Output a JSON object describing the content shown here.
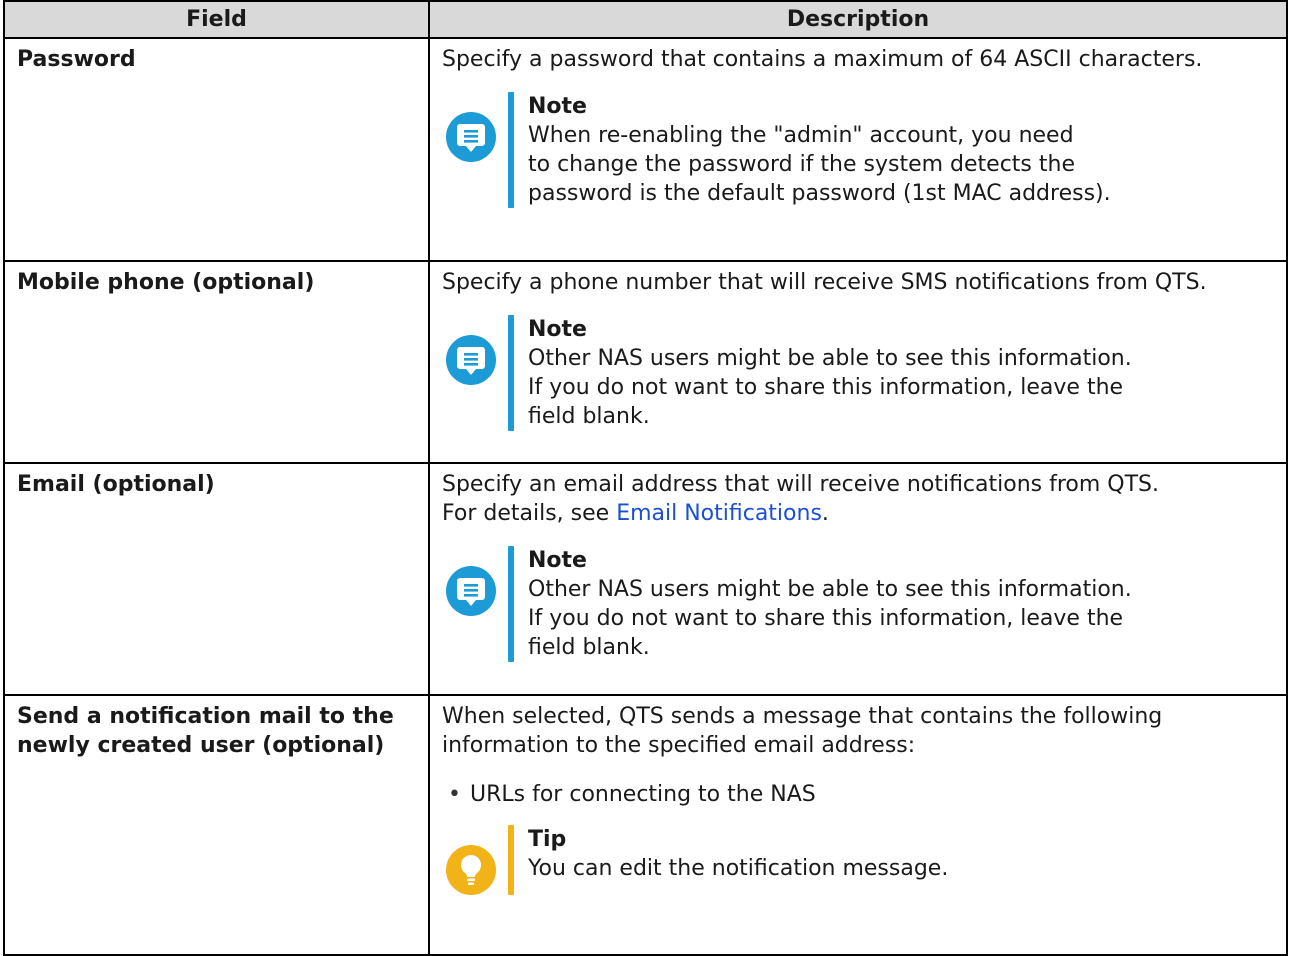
{
  "table": {
    "headers": [
      "Field",
      "Description"
    ],
    "rows": [
      {
        "field": "Password",
        "description": "Specify a password that contains a maximum of 64 ASCII characters.",
        "note": {
          "title": "Note",
          "text": "When re-enabling the \"admin\" account, you need\nto change the password if the system detects the\npassword is the default password (1st MAC address)."
        }
      },
      {
        "field": "Mobile phone (optional)",
        "description": "Specify a phone number that will receive SMS notifications from QTS.",
        "note": {
          "title": "Note",
          "text": "Other NAS users might be able to see this information.\nIf you do not want to share this information, leave the\nfield blank."
        }
      },
      {
        "field": "Email (optional)",
        "description": "Specify an email address that will receive notifications from QTS.",
        "details_prefix": "For details, see ",
        "details_link": "Email Notifications",
        "details_suffix": ".",
        "note": {
          "title": "Note",
          "text": "Other NAS users might be able to see this information.\nIf you do not want to share this information, leave the\nfield blank."
        }
      },
      {
        "field": "Send a notification mail to the newly created user (optional)",
        "description": "When selected, QTS sends a message that contains the following information to the specified email address:",
        "bullets": [
          "URLs for connecting to the NAS"
        ],
        "tip": {
          "title": "Tip",
          "text": "You can edit the notification message."
        }
      }
    ]
  },
  "colors": {
    "note_accent": "#1d9bd6",
    "tip_accent": "#f2b319",
    "link": "#1b4fd6",
    "header_bg": "#d9d9d9"
  },
  "icons": {
    "note": "note-speech-bubble-icon",
    "tip": "lightbulb-icon"
  }
}
